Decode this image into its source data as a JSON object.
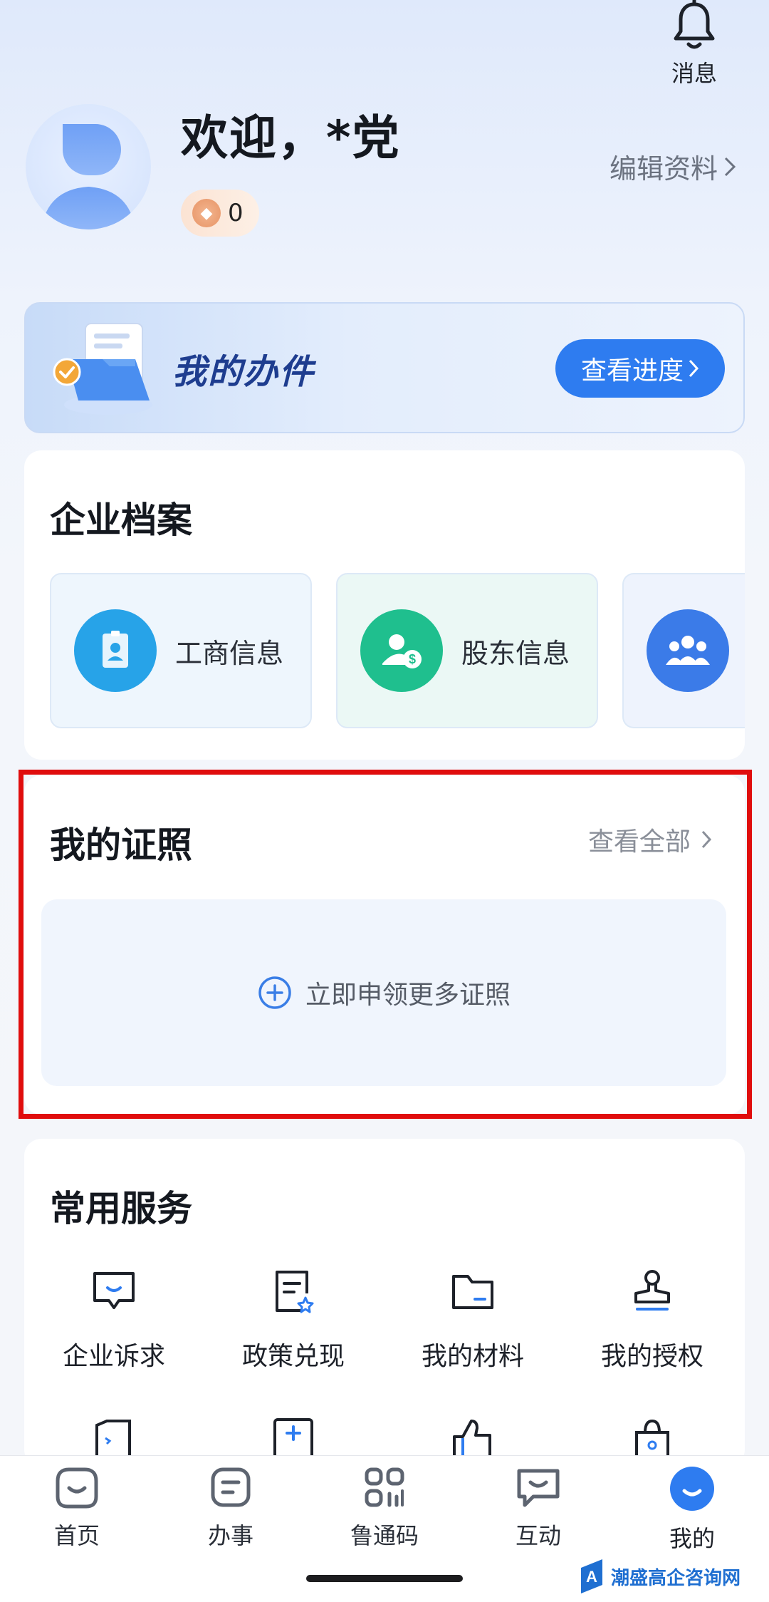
{
  "header": {
    "message_label": "消息",
    "welcome": "欢迎，*党",
    "points_value": "0",
    "edit_profile": "编辑资料"
  },
  "banner": {
    "title": "我的办件",
    "progress_button": "查看进度"
  },
  "enterprise": {
    "title": "企业档案",
    "tiles": [
      {
        "label": "工商信息",
        "icon": "id-card-icon",
        "color": "#27a3e8"
      },
      {
        "label": "股东信息",
        "icon": "shareholder-icon",
        "color": "#1fbf8e"
      },
      {
        "label": "",
        "icon": "team-icon",
        "color": "#3b7be8"
      }
    ]
  },
  "licenses": {
    "title": "我的证照",
    "view_all": "查看全部",
    "apply_more": "立即申领更多证照"
  },
  "services": {
    "title": "常用服务",
    "items": [
      {
        "label": "企业诉求",
        "icon": "message-icon"
      },
      {
        "label": "政策兑现",
        "icon": "policy-doc-icon"
      },
      {
        "label": "我的材料",
        "icon": "folder-icon"
      },
      {
        "label": "我的授权",
        "icon": "stamp-icon"
      }
    ]
  },
  "tabbar": {
    "items": [
      {
        "label": "首页",
        "icon": "home-icon"
      },
      {
        "label": "办事",
        "icon": "task-icon"
      },
      {
        "label": "鲁通码",
        "icon": "qrcode-icon"
      },
      {
        "label": "互动",
        "icon": "chat-icon"
      },
      {
        "label": "我的",
        "icon": "profile-icon",
        "active": true
      }
    ]
  },
  "watermark": "潮盛高企咨询网",
  "colors": {
    "primary": "#2e7cf0",
    "highlight_frame": "#e00d0d"
  }
}
